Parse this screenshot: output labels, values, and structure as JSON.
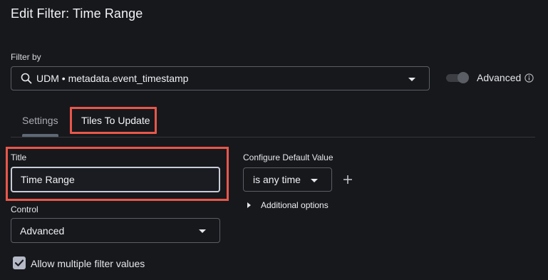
{
  "dialog": {
    "title": "Edit Filter: Time Range"
  },
  "filter_by": {
    "label": "Filter by",
    "value": "UDM • metadata.event_timestamp",
    "icon": "search-icon"
  },
  "advanced": {
    "label": "Advanced",
    "enabled": false,
    "info_icon": "info-icon"
  },
  "tabs": [
    {
      "label": "Settings",
      "active": true
    },
    {
      "label": "Tiles To Update",
      "active": false,
      "highlighted": true
    }
  ],
  "form": {
    "title_label": "Title",
    "title_value": "Time Range",
    "control_label": "Control",
    "control_value": "Advanced",
    "allow_multiple_label": "Allow multiple filter values",
    "allow_multiple_checked": true,
    "default_value_label": "Configure Default Value",
    "default_value": "is any time",
    "additional_options_label": "Additional options"
  },
  "colors": {
    "background": "#17181c",
    "highlight": "#e8574b",
    "border": "#5b5e66"
  }
}
